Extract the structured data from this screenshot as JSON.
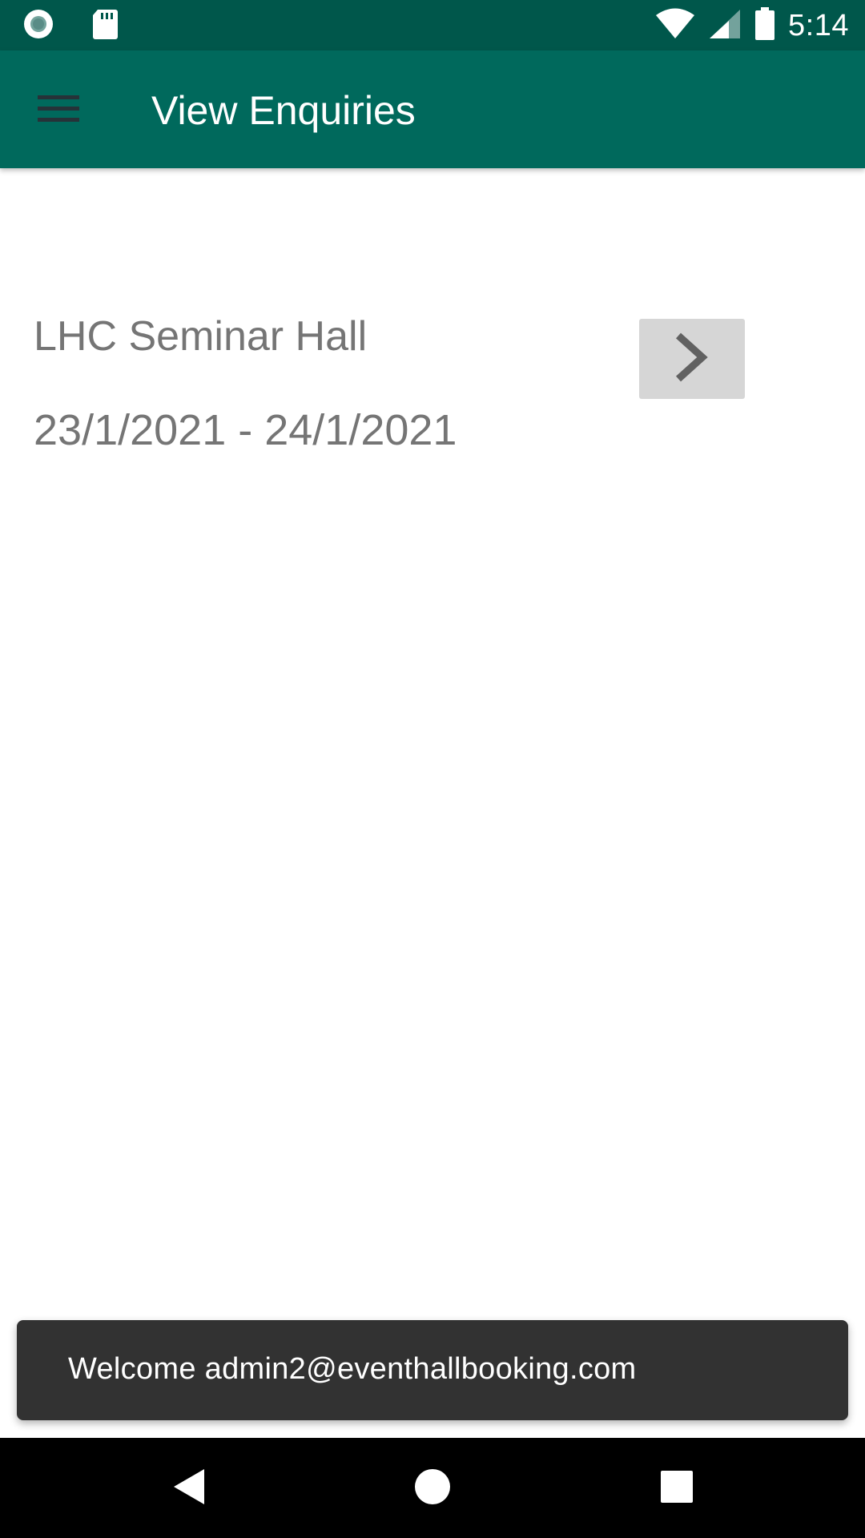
{
  "status_bar": {
    "time": "5:14",
    "icons": [
      "record-icon",
      "sd-card-icon",
      "wifi-icon",
      "signal-icon",
      "battery-icon"
    ]
  },
  "app_bar": {
    "title": "View Enquiries",
    "menu_icon": "hamburger-menu-icon",
    "color": "#00695c",
    "status_color": "#00574b"
  },
  "enquiries": [
    {
      "hall_name": "LHC Seminar Hall",
      "date_range": "23/1/2021 - 24/1/2021",
      "action_icon": "chevron-right-icon"
    }
  ],
  "snackbar": {
    "message": "Welcome admin2@eventhallbooking.com"
  },
  "nav_bar": {
    "buttons": [
      "back-icon",
      "home-icon",
      "recents-icon"
    ]
  }
}
